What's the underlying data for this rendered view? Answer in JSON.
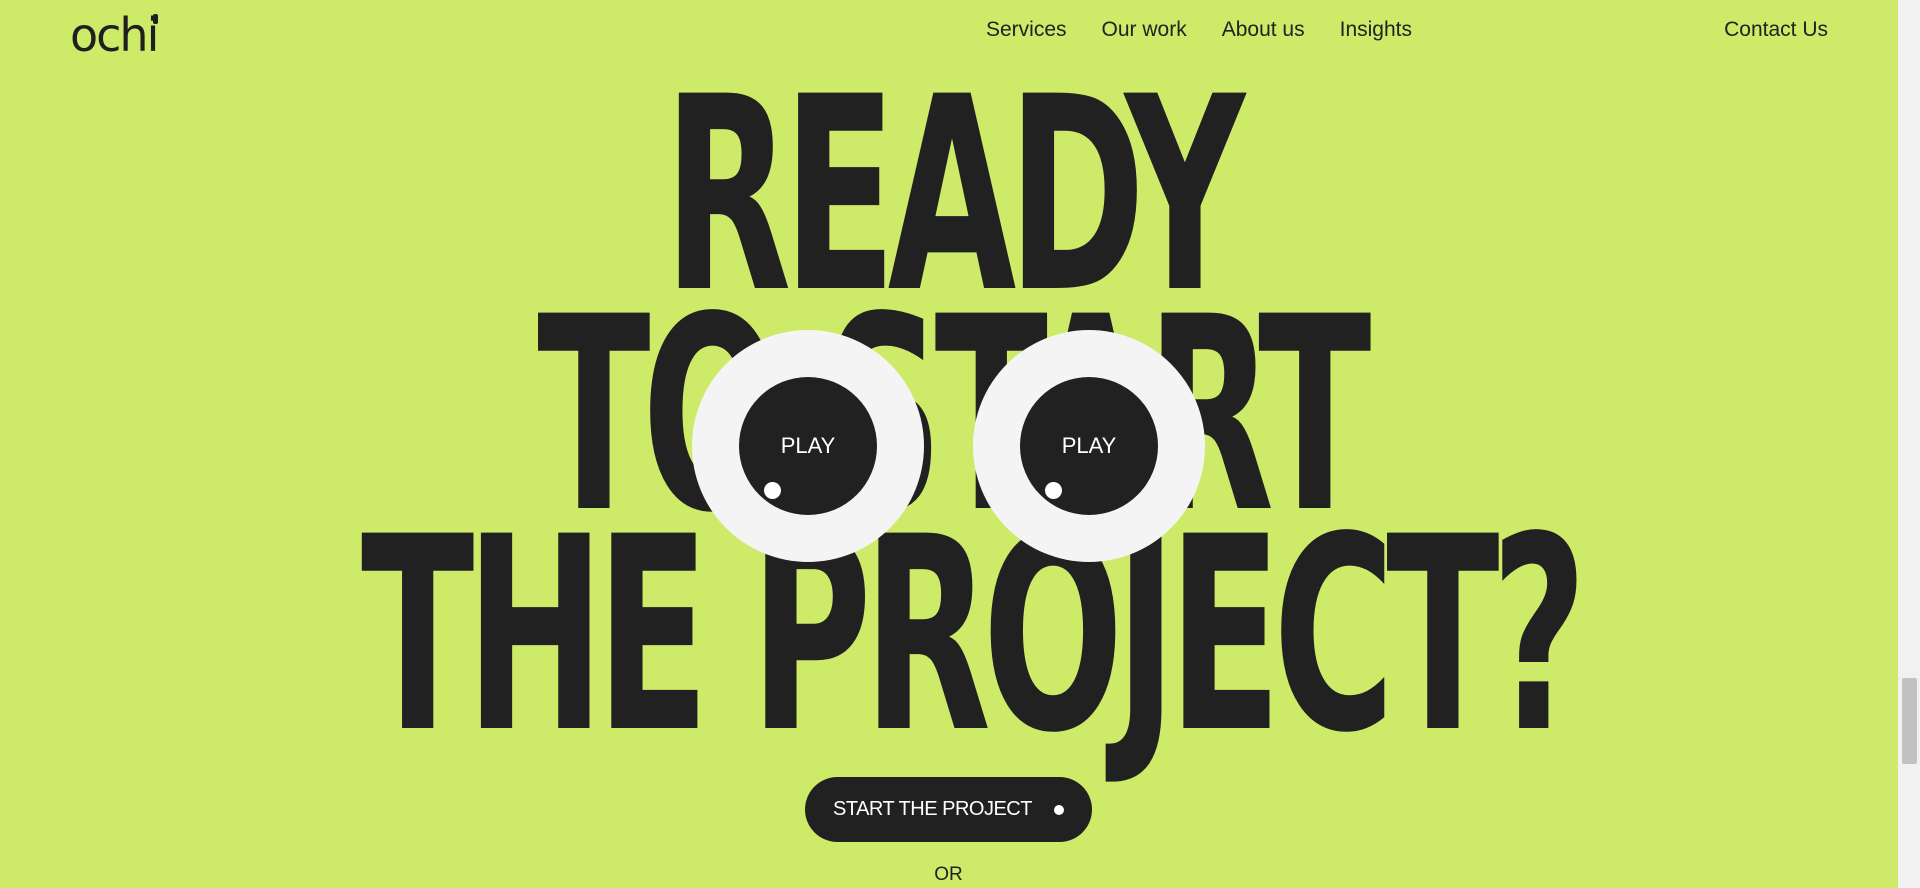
{
  "brand": {
    "logo_text": "ochi"
  },
  "nav": {
    "items": [
      {
        "label": "Services"
      },
      {
        "label": "Our work"
      },
      {
        "label": "About us"
      },
      {
        "label": "Insights"
      }
    ],
    "contact_label": "Contact Us"
  },
  "hero": {
    "lines": [
      "READY",
      "TO START",
      "THE PROJECT?"
    ]
  },
  "eyes": {
    "left_label": "PLAY",
    "right_label": "PLAY"
  },
  "cta": {
    "label": "START THE PROJECT"
  },
  "or_text": "OR",
  "colors": {
    "background": "#cdea68",
    "ink": "#212121",
    "eye_white": "#f4f4f4"
  }
}
